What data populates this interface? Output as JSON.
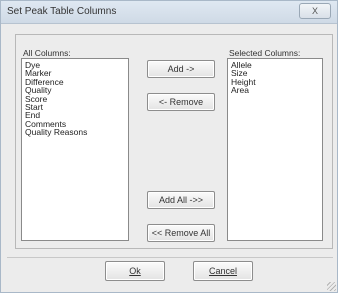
{
  "window": {
    "title": "Set Peak Table Columns",
    "close_label": "X"
  },
  "all_columns": {
    "label": "All Columns:",
    "items": [
      "Dye",
      "Marker",
      "Difference",
      "Quality",
      "Score",
      "Start",
      "End",
      "Comments",
      "Quality Reasons"
    ]
  },
  "selected_columns": {
    "label": "Selected Columns:",
    "items": [
      "Allele",
      "Size",
      "Height",
      "Area"
    ]
  },
  "buttons": {
    "add": "Add ->",
    "remove": "<- Remove",
    "add_all": "Add All ->>",
    "remove_all": "<< Remove All",
    "ok": "Ok",
    "cancel": "Cancel"
  }
}
